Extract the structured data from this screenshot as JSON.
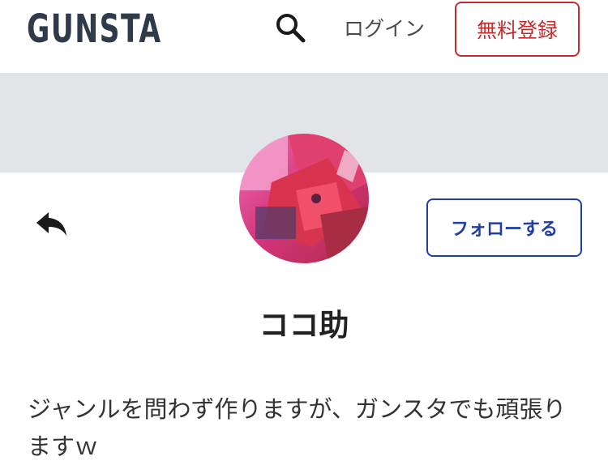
{
  "header": {
    "logo": "GUNSTA",
    "login_label": "ログイン",
    "register_label": "無料登録",
    "search_icon": "search-icon"
  },
  "profile": {
    "username": "ココ助",
    "follow_label": "フォローする",
    "bio": "ジャンルを問わず作りますが、ガンスタでも頑張りますｗ",
    "back_icon": "reply-arrow-icon"
  },
  "colors": {
    "logo": "#2f3b4a",
    "accent_red": "#c62b2b",
    "accent_blue": "#1f3fa6",
    "cover": "#e1e5e8"
  }
}
